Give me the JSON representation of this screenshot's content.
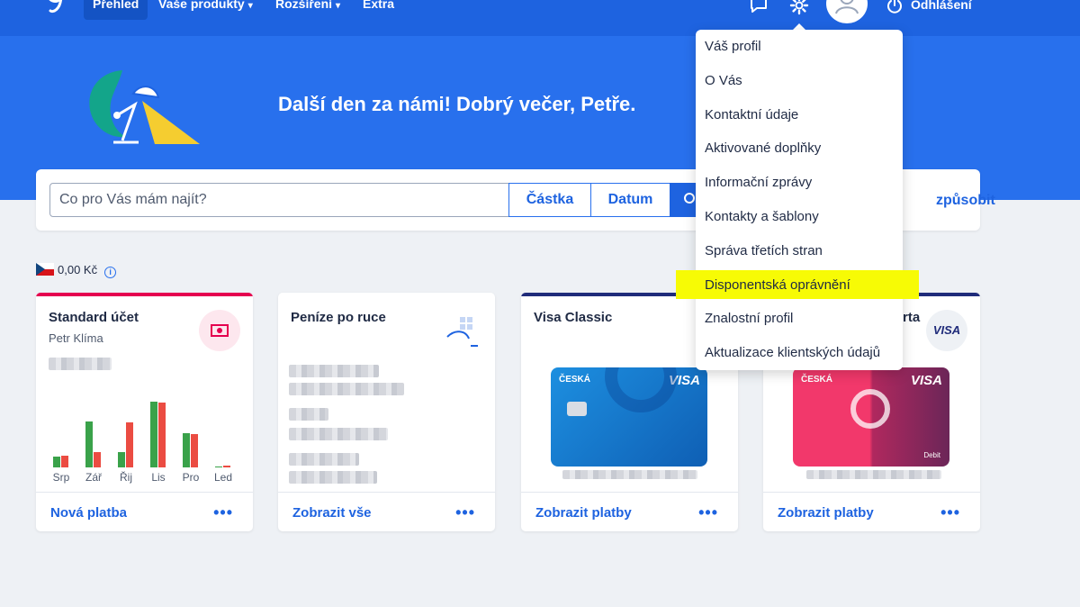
{
  "nav": {
    "items": [
      {
        "label": "Přehled"
      },
      {
        "label": "Vaše produkty"
      },
      {
        "label": "Rozšíření"
      },
      {
        "label": "Extra"
      }
    ],
    "logout_label": "Odhlášení"
  },
  "hero": {
    "greeting": "Další den za námi! Dobrý večer, Petře."
  },
  "search": {
    "placeholder": "Co pro Vás mám najít?",
    "amount_label": "Částka",
    "date_label": "Datum",
    "customize_label": "způsobit"
  },
  "balance": {
    "amount": "0,00 Kč"
  },
  "cards": [
    {
      "title": "Standard účet",
      "subtitle": "Petr Klíma",
      "footer_link": "Nová platba"
    },
    {
      "title": "Peníze po ruce",
      "footer_link": "Zobrazit vše"
    },
    {
      "title": "Visa Classic",
      "footer_link": "Zobrazit platby"
    },
    {
      "title": "rta",
      "footer_link": "Zobrazit platby"
    }
  ],
  "chart_data": {
    "type": "bar",
    "categories": [
      "Srp",
      "Zář",
      "Řij",
      "Lis",
      "Pro",
      "Led"
    ],
    "series": [
      {
        "values": [
          10,
          43,
          14,
          61,
          32,
          1
        ]
      },
      {
        "values": [
          11,
          14,
          42,
          60,
          31,
          2
        ]
      }
    ],
    "colors": [
      "#3aa24a",
      "#eb4c42"
    ]
  },
  "bank_cards": [
    {
      "bank": "ČESKÁ",
      "network": "VISA"
    },
    {
      "bank": "ČESKÁ",
      "network": "VISA",
      "type": "Debit"
    }
  ],
  "visa_badge": "VISA",
  "menu": {
    "items": [
      "Váš profil",
      "O Vás",
      "Kontaktní údaje",
      "Aktivované doplňky",
      "Informační zprávy",
      "Kontakty a šablony",
      "Správa třetích stran",
      "Disponentská oprávnění",
      "Znalostní profil",
      "Aktualizace klientských údajů"
    ]
  },
  "colors": {
    "brand_blue": "#2870ed",
    "nav_blue": "#1e63e0",
    "highlight": "#f7fb05",
    "stripe_red": "#e5004f",
    "stripe_navy": "#1f2b7a"
  }
}
